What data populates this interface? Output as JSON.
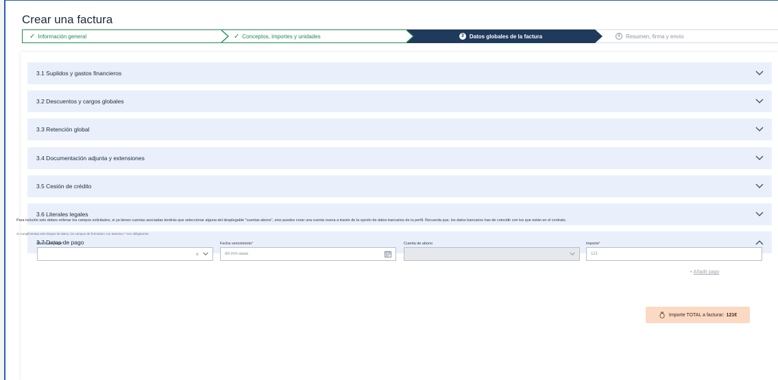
{
  "page": {
    "title": "Crear una factura"
  },
  "stepper": {
    "steps": [
      {
        "label": "Información general",
        "state": "done",
        "icon": "check-icon"
      },
      {
        "label": "Conceptos, importes y unidades",
        "state": "done",
        "icon": "check-icon"
      },
      {
        "label": "Datos globales de la factura",
        "state": "active",
        "number": "3"
      },
      {
        "label": "Resumen, firma y envío",
        "state": "pending",
        "number": "4"
      }
    ]
  },
  "sections": [
    {
      "label": "3.1 Suplidos y gastos financieros",
      "expanded": false
    },
    {
      "label": "3.2 Descuentos y cargos globales",
      "expanded": false
    },
    {
      "label": "3.3 Retención global",
      "expanded": false
    },
    {
      "label": "3.4 Documentación adjunta y extensiones",
      "expanded": false
    },
    {
      "label": "3.5 Cesión de crédito",
      "expanded": false
    },
    {
      "label": "3.6 Literales legales",
      "expanded": false
    },
    {
      "label": "3.7 Datos de pago",
      "expanded": true
    }
  ],
  "payment": {
    "intro": "Para incluirlo solo debes rellenar los campos solicitados, si ya tienes cuentas asociadas tendrás que seleccionar alguna del desplegable \"cuentas abono\", sino puedes crear una cuenta nueva a través de la opción de datos bancarios de tu perfil. Recuerda que, los datos bancarios han de coincidir con los que están en el contrato.",
    "note_prefix": "Si cumplimentas este bloque de datos, los campos de formulario con asterisco",
    "note_asterisk": "*",
    "note_suffix": "son obligatorios.",
    "fields": {
      "medio_label": "Medio de pago",
      "fecha_label": "Fecha vencimiento",
      "cuenta_label": "Cuenta de abono",
      "importe_label": "Importe",
      "asterisk": "*",
      "fecha_placeholder": "dd-mm-aaaa",
      "importe_placeholder": "121"
    },
    "add_label": "Añadir pago"
  },
  "total": {
    "label": "Importe TOTAL a facturar:",
    "amount": "121€"
  },
  "colors": {
    "accent_done": "#1f8a4c",
    "accent_active": "#1f3a5c",
    "section_bg": "#eaf0fb",
    "total_bg": "#fbd9c2",
    "required": "#d1363c"
  }
}
